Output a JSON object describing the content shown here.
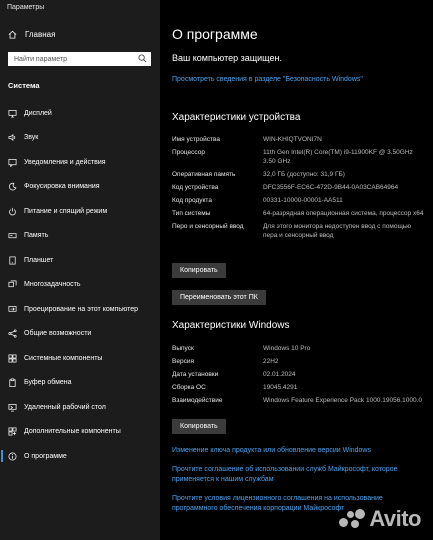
{
  "window": {
    "title": "Параметры"
  },
  "sidebar": {
    "home_label": "Главная",
    "search_placeholder": "Найти параметр",
    "section_title": "Система",
    "items": [
      {
        "label": "Дисплей",
        "icon": "display-icon"
      },
      {
        "label": "Звук",
        "icon": "sound-icon"
      },
      {
        "label": "Уведомления и действия",
        "icon": "notifications-icon"
      },
      {
        "label": "Фокусировка внимания",
        "icon": "focus-assist-icon"
      },
      {
        "label": "Питание и спящий режим",
        "icon": "power-icon"
      },
      {
        "label": "Память",
        "icon": "storage-icon"
      },
      {
        "label": "Планшет",
        "icon": "tablet-icon"
      },
      {
        "label": "Многозадачность",
        "icon": "multitasking-icon"
      },
      {
        "label": "Проецирование на этот компьютер",
        "icon": "projecting-icon"
      },
      {
        "label": "Общие возможности",
        "icon": "shared-experiences-icon"
      },
      {
        "label": "Системные компоненты",
        "icon": "system-components-icon"
      },
      {
        "label": "Буфер обмена",
        "icon": "clipboard-icon"
      },
      {
        "label": "Удаленный рабочий стол",
        "icon": "remote-desktop-icon"
      },
      {
        "label": "Дополнительные компоненты",
        "icon": "optional-features-icon"
      },
      {
        "label": "О программе",
        "icon": "about-icon",
        "active": true
      }
    ]
  },
  "main": {
    "title": "О программе",
    "protected_text": "Ваш компьютер защищен.",
    "security_link": "Просмотреть сведения в разделе \"Безопасность Windows\"",
    "device_specs": {
      "heading": "Характеристики устройства",
      "rows": [
        {
          "k": "Имя устройства",
          "v": "WIN-KHIQTVONI7N"
        },
        {
          "k": "Процессор",
          "v": "11th Gen Intel(R) Core(TM) i9-11900KF @ 3.50GHz   3.50 GHz"
        },
        {
          "k": "Оперативная память",
          "v": "32,0 ГБ (доступно: 31,9 ГБ)"
        },
        {
          "k": "Код устройства",
          "v": "DFC3556F-EC6C-472D-9B44-0A03CAB64964"
        },
        {
          "k": "Код продукта",
          "v": "00331-10000-00001-AA511"
        },
        {
          "k": "Тип системы",
          "v": "64-разрядная операционная система, процессор x64"
        },
        {
          "k": "Перо и сенсорный ввод",
          "v": "Для этого монитора недоступен ввод с помощью пера и сенсорный ввод"
        }
      ],
      "copy_button": "Копировать",
      "rename_button": "Переименовать этот ПК"
    },
    "windows_specs": {
      "heading": "Характеристики Windows",
      "rows": [
        {
          "k": "Выпуск",
          "v": "Windows 10 Pro"
        },
        {
          "k": "Версия",
          "v": "22H2"
        },
        {
          "k": "Дата установки",
          "v": "02.01.2024"
        },
        {
          "k": "Сборка ОС",
          "v": "19045.4291"
        },
        {
          "k": "Взаимодействие",
          "v": "Windows Feature Experience Pack 1000.19056.1000.0"
        }
      ],
      "copy_button": "Копировать"
    },
    "links": [
      "Изменение ключа продукта или обновление версии Windows",
      "Прочтите соглашение об использовании служб Майкрософт, которое применяется к нашим службам",
      "Прочтите условия лицензионного соглашения на использование программного обеспечения корпорации Майкрософт"
    ]
  },
  "watermark": {
    "text": "Avito"
  },
  "colors": {
    "accent": "#3a8fe0",
    "link": "#4aa3f0",
    "sidebar_bg": "#1c1c1c",
    "main_bg": "#000000"
  }
}
